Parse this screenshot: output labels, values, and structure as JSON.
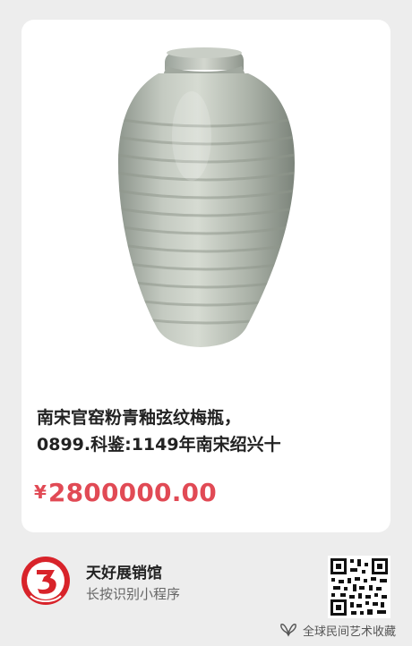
{
  "product": {
    "image_alt_icon": "celadon-vase",
    "title_line1": "南宋官窑粉青釉弦纹梅瓶，",
    "title_line2": "0899.科鉴:1149年南宋绍兴十",
    "currency": "¥",
    "price": "2800000.00"
  },
  "shop": {
    "name": "天好展销馆",
    "hint": "长按识别小程序",
    "logo_icon": "shop-logo-3-icon",
    "qr_icon": "qr-code-icon"
  },
  "watermark": {
    "icon": "wechat-channel-icon",
    "text": "全球民间艺术收藏"
  },
  "colors": {
    "price": "#e14a55",
    "logo_red": "#d8232a",
    "background": "#ededed"
  }
}
